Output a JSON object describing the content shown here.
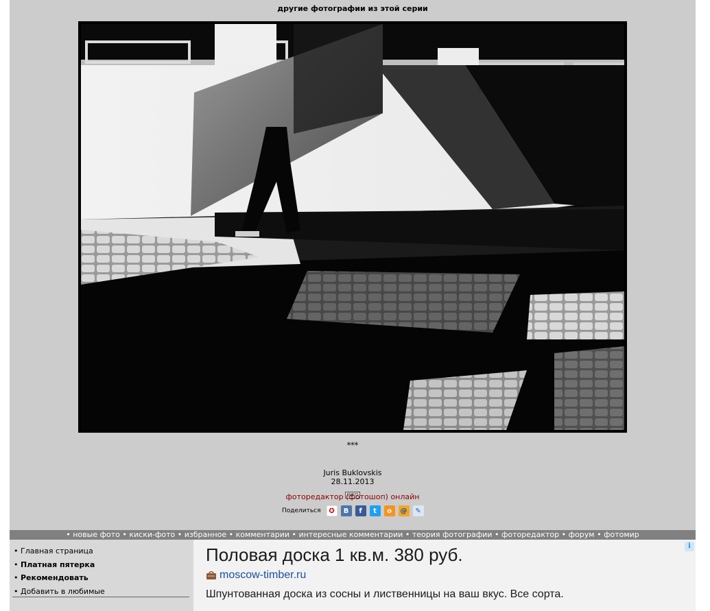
{
  "header": {
    "series_link": "другие фотографии из этой серии"
  },
  "photo": {
    "alt": "black and white street photo: person carrying a large board past a sunlit wall"
  },
  "caption": {
    "title": "***",
    "author": "Juris Buklovskis",
    "date": "28.11.2013",
    "info_badge": "INFO",
    "editor_link": "фоторедактор (фотошоп) онлайн"
  },
  "share": {
    "label": "Поделиться",
    "icons": [
      "person-icon",
      "vk-icon",
      "facebook-icon",
      "twitter-icon",
      "odnoklassniki-icon",
      "mailru-icon",
      "livejournal-icon"
    ]
  },
  "nav": {
    "items": [
      "новые фото",
      "киски-фото",
      "избранное",
      "комментарии",
      "интересные комментарии",
      "теория фотографии",
      "фоторедактор",
      "форум",
      "фотомир"
    ]
  },
  "menu": {
    "items": [
      {
        "label": "Главная страница",
        "bold": false
      },
      {
        "label": "Платная пятерка",
        "bold": true
      },
      {
        "label": "Рекомендовать",
        "bold": true
      },
      {
        "label": "Добавить в любимые",
        "bold": false
      }
    ]
  },
  "ad": {
    "title": "Половая доска 1 кв.м. 380 руб.",
    "domain": "moscow-timber.ru",
    "text": "Шпунтованная доска из сосны и лиственницы на ваш вкус. Все сорта.",
    "info_icon": "i"
  },
  "colors": {
    "page_bg": "#cccccc",
    "nav_bg": "#808080",
    "link_red": "#8b0000",
    "ad_domain": "#1a4fa0"
  }
}
